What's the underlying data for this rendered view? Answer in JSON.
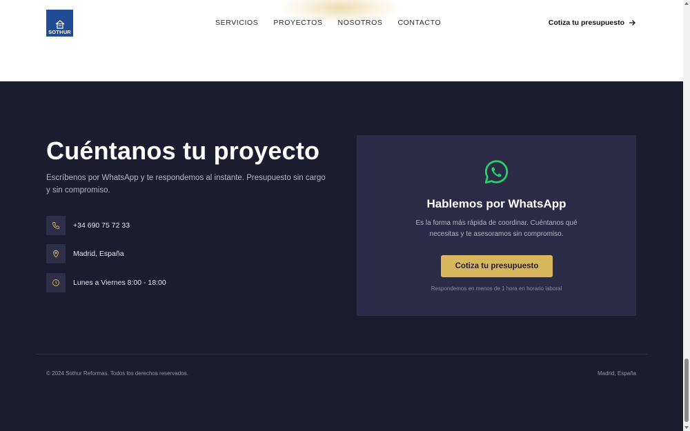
{
  "header": {
    "logo_text": "SOTHUR",
    "nav": [
      "SERVICIOS",
      "PROYECTOS",
      "NOSOTROS",
      "CONTACTO"
    ],
    "cta_label": "Cotiza tu presupuesto",
    "cta_icon": "arrow-right-icon"
  },
  "contact": {
    "title": "Cuéntanos tu proyecto",
    "subtitle": "Escríbenos por WhatsApp y te respondemos al instante. Presupuesto sin cargo y sin compromiso.",
    "items": [
      {
        "icon": "phone-icon",
        "text": "+34 690 75 72 33"
      },
      {
        "icon": "location-pin-icon",
        "text": "Madrid, España"
      },
      {
        "icon": "clock-icon",
        "text": "Lunes a Viernes 8:00 - 18:00"
      }
    ]
  },
  "card": {
    "icon": "whatsapp-icon",
    "title": "Hablemos por WhatsApp",
    "text": "Es la forma más rápida de coordinar. Cuéntanos qué necesitas y te asesoramos sin compromiso.",
    "button_label": "Cotiza tu presupuesto",
    "note": "Respondemos en menos de 1 hora en horario laboral"
  },
  "footer": {
    "copyright": "© 2024 Sothur Reformas. Todos los derechos reservados.",
    "location": "Madrid, España"
  },
  "colors": {
    "dark_bg": "#1c1c30",
    "card_bg": "#2b2b47",
    "accent_gold": "#d8b75c",
    "logo_blue": "#1f4c94",
    "whatsapp_green": "#25d366"
  }
}
